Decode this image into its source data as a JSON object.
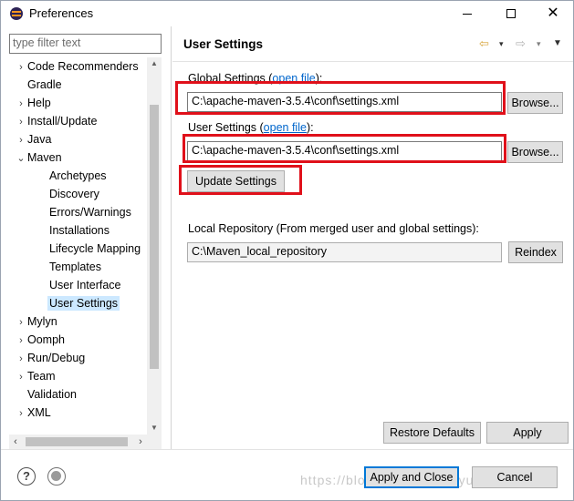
{
  "window": {
    "title": "Preferences",
    "close_glyph": "✕"
  },
  "filter": {
    "placeholder": "type filter text"
  },
  "tree": {
    "items": [
      {
        "label": "Code Recommenders",
        "arrow": "›"
      },
      {
        "label": "Gradle",
        "arrow": ""
      },
      {
        "label": "Help",
        "arrow": "›"
      },
      {
        "label": "Install/Update",
        "arrow": "›"
      },
      {
        "label": "Java",
        "arrow": "›"
      },
      {
        "label": "Maven",
        "arrow": "⌄"
      },
      {
        "label": "Archetypes",
        "arrow": ""
      },
      {
        "label": "Discovery",
        "arrow": ""
      },
      {
        "label": "Errors/Warnings",
        "arrow": ""
      },
      {
        "label": "Installations",
        "arrow": ""
      },
      {
        "label": "Lifecycle Mapping",
        "arrow": ""
      },
      {
        "label": "Templates",
        "arrow": ""
      },
      {
        "label": "User Interface",
        "arrow": ""
      },
      {
        "label": "User Settings",
        "arrow": ""
      },
      {
        "label": "Mylyn",
        "arrow": "›"
      },
      {
        "label": "Oomph",
        "arrow": "›"
      },
      {
        "label": "Run/Debug",
        "arrow": "›"
      },
      {
        "label": "Team",
        "arrow": "›"
      },
      {
        "label": "Validation",
        "arrow": ""
      },
      {
        "label": "XML",
        "arrow": "›"
      }
    ],
    "selected": "User Settings"
  },
  "page": {
    "title": "User Settings",
    "global_label_a": "Global Settings (",
    "global_link": "open file",
    "global_label_b": "):",
    "global_value": "C:\\apache-maven-3.5.4\\conf\\settings.xml",
    "user_label_a": "User Settings (",
    "user_link": "open file",
    "user_label_b": "):",
    "user_value": "C:\\apache-maven-3.5.4\\conf\\settings.xml",
    "browse_label": "Browse...",
    "update_label": "Update Settings",
    "local_repo_label": "Local Repository (From merged user and global settings):",
    "local_repo_value": "C:\\Maven_local_repository",
    "reindex_label": "Reindex",
    "restore_defaults_label": "Restore Defaults",
    "apply_label": "Apply"
  },
  "footer": {
    "apply_close_label": "Apply and Close",
    "cancel_label": "Cancel",
    "help_glyph": "?",
    "watermark": "https://blog.csdn.net/taoyue"
  },
  "nav_icons": {
    "back": "⇦",
    "forward": "⇨",
    "dropdown": "▾",
    "menu": "▼"
  },
  "colors": {
    "highlight_red": "#e0101a",
    "link_blue": "#0066cc",
    "selection": "#cce8ff"
  }
}
